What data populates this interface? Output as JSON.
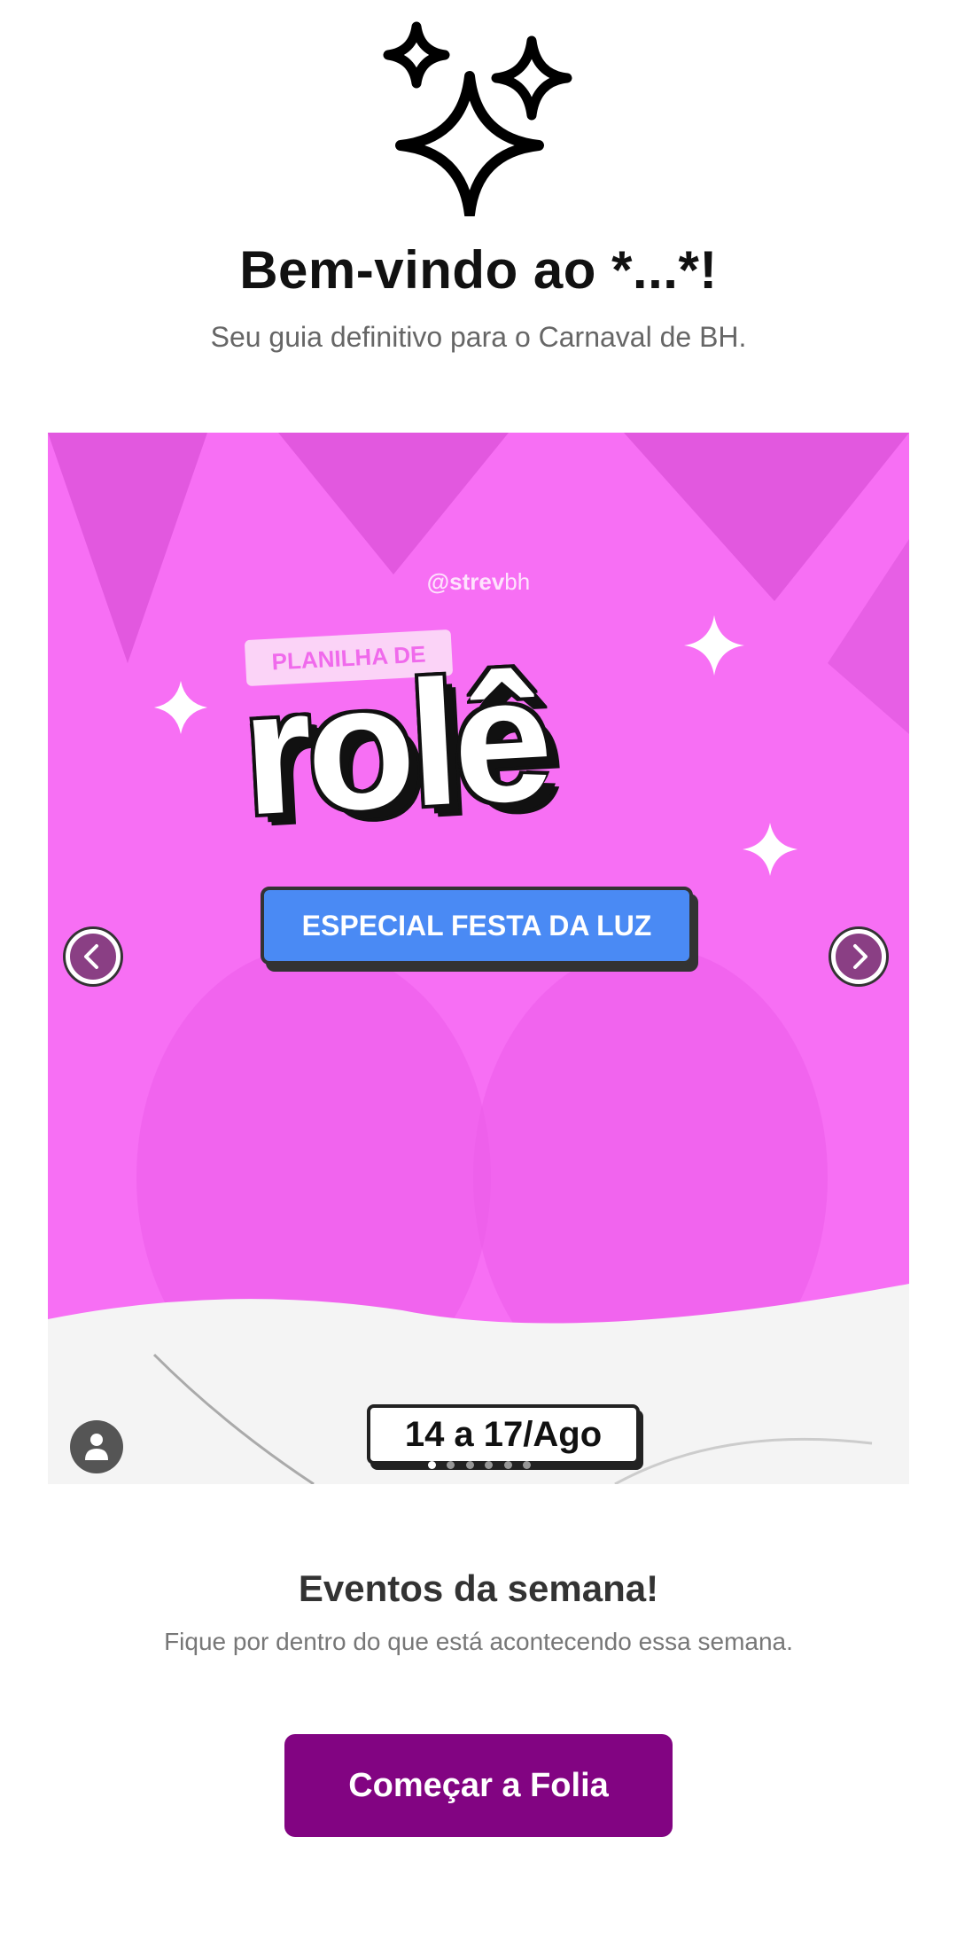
{
  "header": {
    "icon": "sparkles-icon",
    "title": "Bem-vindo ao *...*!",
    "subtitle": "Seu guia definitivo para o Carnaval de BH."
  },
  "carousel": {
    "slide": {
      "handle_bold": "@strev",
      "handle_light": "bh",
      "tag": "PLANILHA DE",
      "headline": "rolê",
      "banner": "ESPECIAL FESTA DA LUZ",
      "dates": "14 a 17/Ago"
    },
    "active_slide": 1,
    "slide_count": 6,
    "prev_icon": "chevron-left-icon",
    "next_icon": "chevron-right-icon",
    "avatar_icon": "user-icon"
  },
  "events": {
    "title": "Eventos da semana!",
    "subtitle": "Fique por dentro do que está acontecendo essa semana."
  },
  "cta": {
    "label": "Começar a Folia"
  },
  "colors": {
    "accent": "#820482",
    "slide_bg": "#f76ff4",
    "banner": "#4a8af4"
  }
}
